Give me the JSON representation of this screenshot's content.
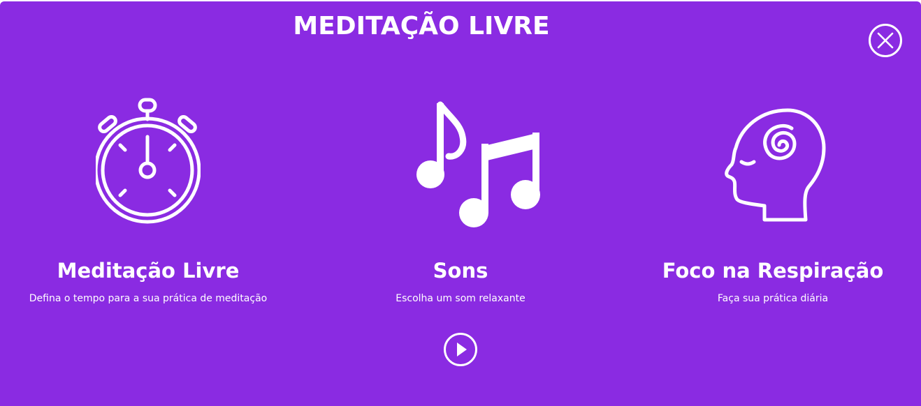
{
  "header": {
    "title": "MEDITAÇÃO LIVRE",
    "close_icon": "close-circle-icon"
  },
  "cards": [
    {
      "icon": "stopwatch-icon",
      "label": "Meditação Livre",
      "description": "Defina o tempo para a sua prática de meditação"
    },
    {
      "icon": "music-notes-icon",
      "label": "Sons",
      "description": "Escolha um som relaxante"
    },
    {
      "icon": "mind-head-icon",
      "label": "Foco na Respiração",
      "description": "Faça sua prática diária"
    }
  ],
  "controls": {
    "play_icon": "play-circle-icon"
  },
  "colors": {
    "background": "#8a2be2",
    "foreground": "#ffffff"
  }
}
